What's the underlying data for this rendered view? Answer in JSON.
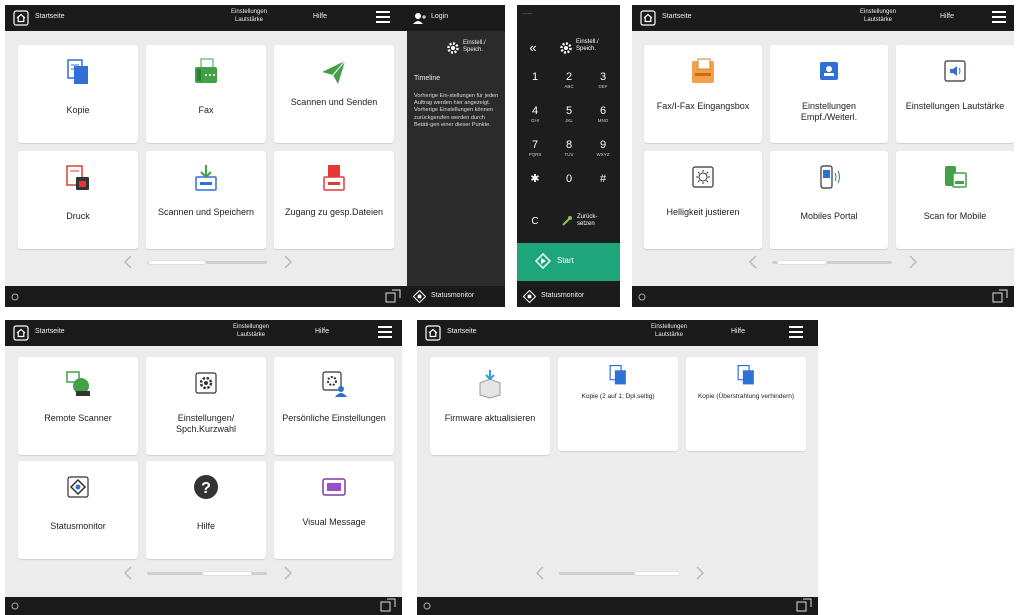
{
  "colors": {
    "topbar": "#1a1a1a",
    "panel_bg": "#ececec",
    "start_green": "#1ea67a",
    "accent_blue": "#2f6fd6",
    "fax_green": "#43a047",
    "scan_red": "#e53935"
  },
  "topbar": {
    "home_label": "Startseite",
    "volume_label_1": "Einstellungen",
    "volume_label_2": "Lautstärke",
    "help_label": "Hilfe"
  },
  "panel1": {
    "tiles": [
      {
        "label": "Kopie",
        "icon": "copy-icon"
      },
      {
        "label": "Fax",
        "icon": "fax-icon"
      },
      {
        "label": "Scannen und Senden",
        "icon": "scan-send-icon"
      },
      {
        "label": "Druck",
        "icon": "print-icon"
      },
      {
        "label": "Scannen und Speichern",
        "icon": "scan-store-icon"
      },
      {
        "label": "Zugang zu gesp.Dateien",
        "icon": "stored-files-icon"
      }
    ]
  },
  "side": {
    "login_label": "Login",
    "settings_label_1": "Einstell./",
    "settings_label_2": "Speich.",
    "timeline_title": "Timeline",
    "timeline_text": "Vorherige Ein-stellungen für jeden Auftrag werden hier angezeigt. Vorherige Einstellungen können zurückgerufen werden durch Betäti-gen einer dieser Punkte.",
    "status_label": "Statusmonitor"
  },
  "keypad": {
    "top_label": "----",
    "settings_label_1": "Einstell./",
    "settings_label_2": "Speich.",
    "keys": [
      {
        "d": "1",
        "s": ""
      },
      {
        "d": "2",
        "s": "ABC"
      },
      {
        "d": "3",
        "s": "DEF"
      },
      {
        "d": "4",
        "s": "GHI"
      },
      {
        "d": "5",
        "s": "JKL"
      },
      {
        "d": "6",
        "s": "MNO"
      },
      {
        "d": "7",
        "s": "PQRS"
      },
      {
        "d": "8",
        "s": "TUV"
      },
      {
        "d": "9",
        "s": "WXYZ"
      },
      {
        "d": "✱",
        "s": ""
      },
      {
        "d": "0",
        "s": ""
      },
      {
        "d": "#",
        "s": ""
      }
    ],
    "clear_label": "C",
    "reset_label_1": "Zurück-",
    "reset_label_2": "setzen",
    "start_label": "Start",
    "status_label": "Statusmonitor"
  },
  "panel2": {
    "tiles": [
      {
        "label": "Fax/I-Fax Eingangsbox",
        "icon": "fax-inbox-icon"
      },
      {
        "label": "Einstellungen Empf./Weiterl.",
        "icon": "rx-forward-icon"
      },
      {
        "label": "Einstellungen Lautstärke",
        "icon": "volume-icon"
      },
      {
        "label": "Helligkeit justieren",
        "icon": "brightness-icon"
      },
      {
        "label": "Mobiles Portal",
        "icon": "mobile-portal-icon"
      },
      {
        "label": "Scan for Mobile",
        "icon": "scan-mobile-icon"
      }
    ]
  },
  "panel3": {
    "tiles": [
      {
        "label": "Remote Scanner",
        "icon": "remote-scanner-icon"
      },
      {
        "label": "Einstellungen/ Spch.Kurzwahl",
        "icon": "settings-gear-icon"
      },
      {
        "label": "Persönliche Einstellungen",
        "icon": "personal-settings-icon"
      },
      {
        "label": "Statusmonitor",
        "icon": "status-monitor-icon"
      },
      {
        "label": "Hilfe",
        "icon": "help-icon"
      },
      {
        "label": "Visual Message",
        "icon": "visual-message-icon"
      }
    ]
  },
  "panel4": {
    "tiles": [
      {
        "label": "Firmware aktualisieren",
        "icon": "firmware-icon"
      },
      {
        "label": "Kopie (2 auf 1; Dpl.seitig)",
        "icon": "copy-preset-icon"
      },
      {
        "label": "Kopie (Überstrahlung verhindern)",
        "icon": "copy-preset-icon"
      }
    ]
  }
}
